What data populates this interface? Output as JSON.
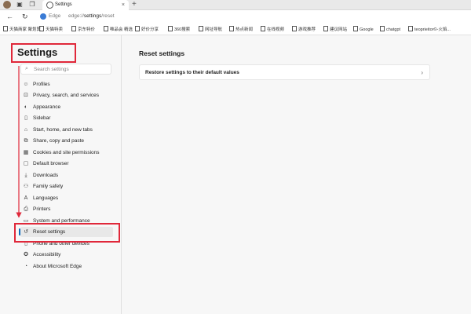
{
  "tabbar": {
    "tab_title": "Settings",
    "close_glyph": "×",
    "new_tab_glyph": "+"
  },
  "address": {
    "back_glyph": "←",
    "refresh_glyph": "↻",
    "edge_label": "Edge",
    "url_prefix": "edge://",
    "url_path": "settings",
    "url_suffix": "/reset"
  },
  "favorites": [
    {
      "label": "天猫商家 聚划算"
    },
    {
      "label": "天猫特卖"
    },
    {
      "label": "京东特价"
    },
    {
      "label": "唯品会 精选"
    },
    {
      "label": "好价分享"
    },
    {
      "label": "360搜索"
    },
    {
      "label": "网址导航"
    },
    {
      "label": "热点新闻"
    },
    {
      "label": "在线视频"
    },
    {
      "label": "游戏推荐"
    },
    {
      "label": "建议网站"
    },
    {
      "label": "Google"
    },
    {
      "label": "chatgpt"
    },
    {
      "label": "teoprieitor©-火焰..."
    }
  ],
  "sidebar": {
    "title": "Settings",
    "search_placeholder": "Search settings",
    "items": [
      {
        "label": "Profiles",
        "icon": "person-icon"
      },
      {
        "label": "Privacy, search, and services",
        "icon": "lock-icon"
      },
      {
        "label": "Appearance",
        "icon": "palette-icon"
      },
      {
        "label": "Sidebar",
        "icon": "sidebar-icon"
      },
      {
        "label": "Start, home, and new tabs",
        "icon": "home-icon"
      },
      {
        "label": "Share, copy and paste",
        "icon": "share-icon"
      },
      {
        "label": "Cookies and site permissions",
        "icon": "cookie-icon"
      },
      {
        "label": "Default browser",
        "icon": "browser-icon"
      },
      {
        "label": "Downloads",
        "icon": "download-icon"
      },
      {
        "label": "Family safety",
        "icon": "family-icon"
      },
      {
        "label": "Languages",
        "icon": "language-icon"
      },
      {
        "label": "Printers",
        "icon": "printer-icon"
      },
      {
        "label": "System and performance",
        "icon": "system-icon"
      },
      {
        "label": "Reset settings",
        "icon": "reset-icon"
      },
      {
        "label": "Phone and other devices",
        "icon": "phone-icon"
      },
      {
        "label": "Accessibility",
        "icon": "accessibility-icon"
      },
      {
        "label": "About Microsoft Edge",
        "icon": "edge-icon"
      }
    ]
  },
  "main": {
    "title": "Reset settings",
    "restore_label": "Restore settings to their default values",
    "chevron": "›"
  },
  "annotations": {
    "highlight_color": "#e0283a",
    "active_indicator_color": "#0f6cbd"
  }
}
